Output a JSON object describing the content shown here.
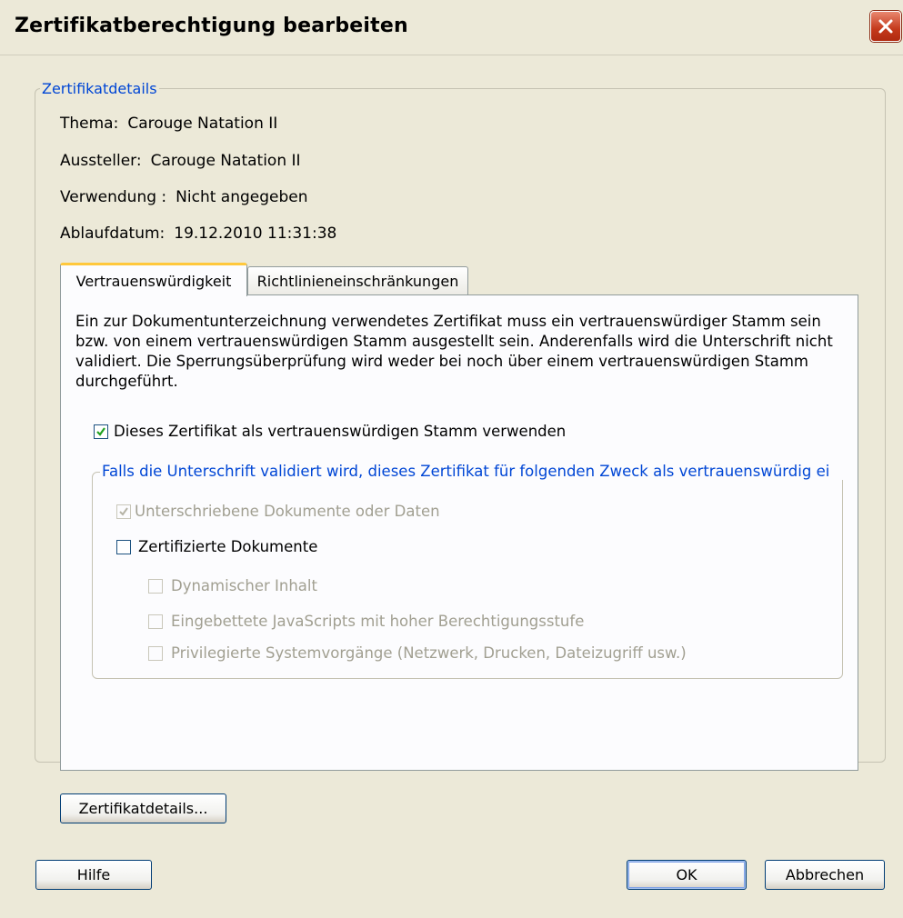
{
  "window": {
    "title": "Zertifikatberechtigung bearbeiten"
  },
  "details": {
    "legend": "Zertifikatdetails",
    "rows": [
      {
        "label": "Thema:",
        "value": "Carouge Natation II"
      },
      {
        "label": "Aussteller:",
        "value": "Carouge Natation II"
      },
      {
        "label": "Verwendung :",
        "value": "Nicht angegeben"
      },
      {
        "label": "Ablaufdatum:",
        "value": "19.12.2010 11:31:38"
      }
    ]
  },
  "tabs": [
    {
      "label": "Vertrauenswürdigkeit",
      "active": true
    },
    {
      "label": "Richtlinieneinschränkungen",
      "active": false
    }
  ],
  "trust": {
    "description": "Ein zur Dokumentunterzeichnung verwendetes Zertifikat muss ein vertrauenswürdiger Stamm sein bzw. von einem vertrauenswürdigen Stamm ausgestellt sein. Anderenfalls wird die Unterschrift nicht validiert. Die Sperrungsüberprüfung wird weder bei noch über einem vertrauenswürdigen Stamm durchgeführt.",
    "root_checkbox": {
      "label": "Dieses Zertifikat als vertrauenswürdigen Stamm verwenden",
      "checked": true
    },
    "purpose_legend": "Falls die Unterschrift validiert wird, dieses Zertifikat für folgenden Zweck als vertrauenswürdig ei",
    "signed_docs": {
      "label": "Unterschriebene Dokumente oder Daten",
      "checked": true,
      "enabled": false
    },
    "certified_docs": {
      "label": "Zertifizierte Dokumente",
      "checked": false,
      "enabled": true
    },
    "dynamic_content": {
      "label": "Dynamischer Inhalt",
      "checked": false,
      "enabled": false
    },
    "embedded_js": {
      "label": "Eingebettete JavaScripts mit hoher Berechtigungsstufe",
      "checked": false,
      "enabled": false
    },
    "privileged_ops": {
      "label": "Privilegierte Systemvorgänge (Netzwerk, Drucken, Dateizugriff usw.)",
      "checked": false,
      "enabled": false
    }
  },
  "buttons": {
    "cert_details": "Zertifikatdetails...",
    "help": "Hilfe",
    "ok": "OK",
    "cancel": "Abbrechen"
  },
  "colors": {
    "dialog_bg": "#ece9d8",
    "accent_blue": "#0046d5",
    "close_red": "#c4391b",
    "active_tab_highlight": "#ffc83c",
    "checkmark_green": "#21a121",
    "disabled_text": "#a19f91"
  },
  "icons": {
    "close": "close-x-icon",
    "check": "checkmark-icon"
  }
}
